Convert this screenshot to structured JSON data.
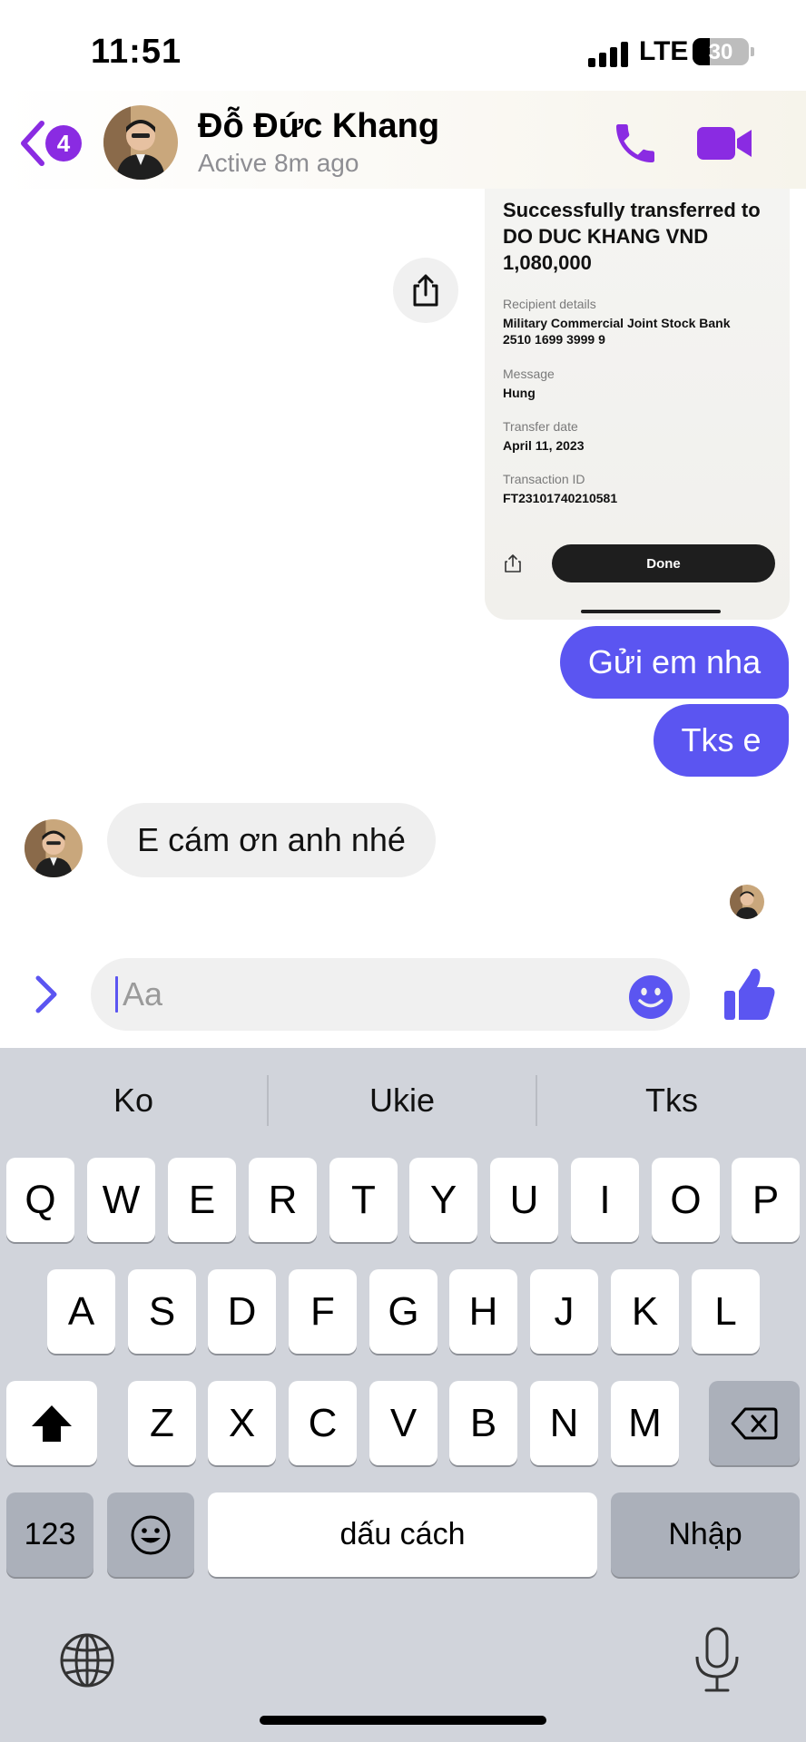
{
  "status_bar": {
    "time": "11:51",
    "network": "LTE",
    "battery_percent": "30",
    "battery_level": 0.3
  },
  "header": {
    "back_badge_count": "4",
    "contact_name": "Đỗ Đức Khang",
    "contact_status": "Active 8m ago",
    "accent_color": "#8a2be2"
  },
  "receipt": {
    "title": "Successfully transferred to DO DUC KHANG VND 1,080,000",
    "recipient_label": "Recipient details",
    "recipient_bank": "Military Commercial Joint Stock Bank",
    "recipient_account": "2510 1699 3999 9",
    "message_label": "Message",
    "message_value": "Hung",
    "date_label": "Transfer date",
    "date_value": "April 11, 2023",
    "txn_label": "Transaction ID",
    "txn_value": "FT23101740210581",
    "done_label": "Done"
  },
  "messages": [
    {
      "direction": "outgoing",
      "text": "Gửi em nha"
    },
    {
      "direction": "outgoing",
      "text": "Tks e"
    },
    {
      "direction": "incoming",
      "text": "E cám ơn anh nhé"
    }
  ],
  "composer": {
    "placeholder": "Aa",
    "bubble_color": "#5b55f1"
  },
  "keyboard": {
    "suggestions": [
      "Ko",
      "Ukie",
      "Tks"
    ],
    "row1": [
      "Q",
      "W",
      "E",
      "R",
      "T",
      "Y",
      "U",
      "I",
      "O",
      "P"
    ],
    "row2": [
      "A",
      "S",
      "D",
      "F",
      "G",
      "H",
      "J",
      "K",
      "L"
    ],
    "row3": [
      "Z",
      "X",
      "C",
      "V",
      "B",
      "N",
      "M"
    ],
    "numbers_label": "123",
    "space_label": "dấu cách",
    "return_label": "Nhập"
  },
  "icons": {
    "back": "chevron-left-icon",
    "call": "phone-icon",
    "video": "video-camera-icon",
    "share": "share-icon",
    "expand": "chevron-right-icon",
    "emoji": "smiley-icon",
    "like": "thumbs-up-icon",
    "shift": "shift-arrow-icon",
    "delete": "backspace-icon",
    "globe": "globe-icon",
    "mic": "microphone-icon"
  }
}
